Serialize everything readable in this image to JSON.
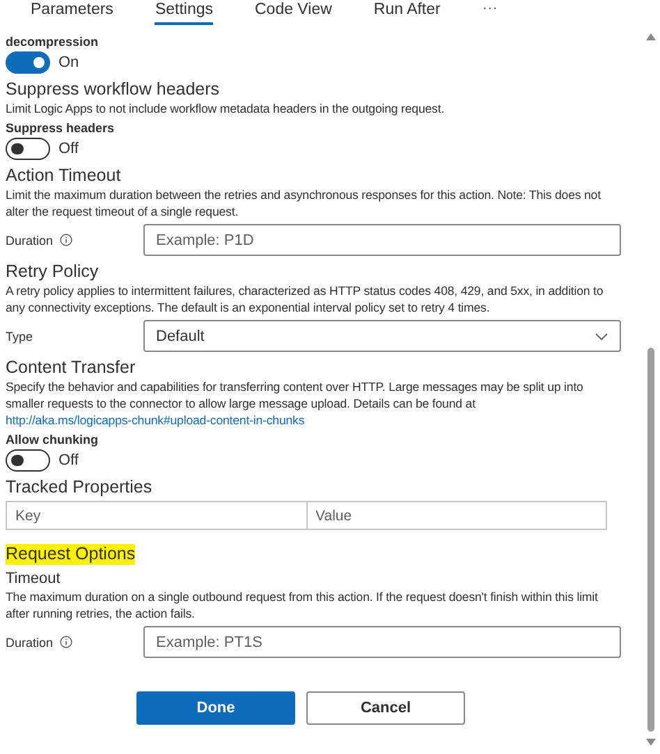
{
  "tabs": [
    {
      "label": "Parameters",
      "selected": false
    },
    {
      "label": "Settings",
      "selected": true
    },
    {
      "label": "Code View",
      "selected": false
    },
    {
      "label": "Run After",
      "selected": false
    }
  ],
  "more_label": "···",
  "items": [
    {
      "kind": "toggle",
      "label": "decompression",
      "on": true,
      "state_text": "On"
    },
    {
      "kind": "heading",
      "text": "Suppress workflow headers"
    },
    {
      "kind": "description",
      "text": "Limit Logic Apps to not include workflow metadata headers in the outgoing request."
    },
    {
      "kind": "toggle",
      "label": "Suppress headers",
      "on": false,
      "state_text": "Off"
    },
    {
      "kind": "heading",
      "text": "Action Timeout"
    },
    {
      "kind": "description",
      "text": "Limit the maximum duration between the retries and asynchronous responses for this action. Note: This does not alter the request timeout of a single request."
    },
    {
      "kind": "field",
      "label": "Duration",
      "info": true,
      "placeholder": "Example: P1D"
    },
    {
      "kind": "heading",
      "text": "Retry Policy"
    },
    {
      "kind": "description",
      "text": "A retry policy applies to intermittent failures, characterized as HTTP status codes 408, 429, and 5xx, in addition to any connectivity exceptions. The default is an exponential interval policy set to retry 4 times."
    },
    {
      "kind": "select",
      "label": "Type",
      "value": "Default"
    },
    {
      "kind": "heading",
      "text": "Content Transfer"
    },
    {
      "kind": "description",
      "text": "Specify the behavior and capabilities for transferring content over HTTP. Large messages may be split up into smaller requests to the connector to allow large message upload. Details can be found at",
      "link": "http://aka.ms/logicapps-chunk#upload-content-in-chunks"
    },
    {
      "kind": "toggle",
      "label": "Allow chunking",
      "on": false,
      "state_text": "Off"
    },
    {
      "kind": "heading",
      "text": "Tracked Properties"
    },
    {
      "kind": "table",
      "placeholders": [
        "Key",
        "Value"
      ]
    },
    {
      "kind": "heading",
      "text": "Request Options",
      "highlighted": true
    },
    {
      "kind": "subheading",
      "text": "Timeout"
    },
    {
      "kind": "description",
      "text": "The maximum duration on a single outbound request from this action. If the request doesn't finish within this limit after running retries, the action fails."
    },
    {
      "kind": "field",
      "label": "Duration",
      "info": true,
      "placeholder": "Example: PT1S"
    }
  ],
  "buttons": [
    {
      "label": "Done",
      "primary": true
    },
    {
      "label": "Cancel",
      "primary": false
    }
  ]
}
